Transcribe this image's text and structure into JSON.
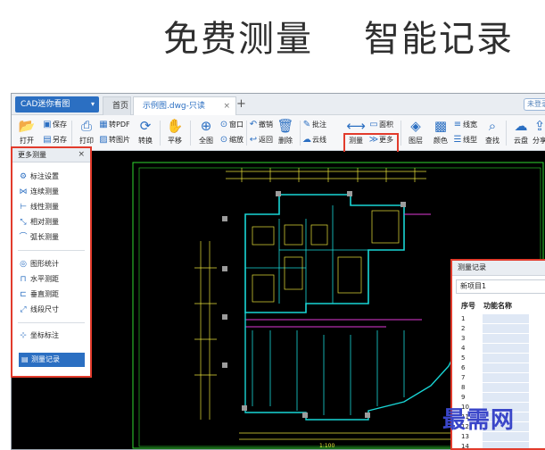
{
  "headline": {
    "left": "免费测量",
    "right": "智能记录"
  },
  "titlebar": {
    "app_menu": "CAD迷你看图",
    "tabs": [
      {
        "label": "首页"
      },
      {
        "label": "示例图.dwg-只读"
      }
    ],
    "add_tab": "+",
    "login_badge": "未登录"
  },
  "toolbar": {
    "open": "打开",
    "save": "保存",
    "save_as": "另存",
    "print": "打印",
    "to_pdf": "转PDF",
    "to_image": "转图片",
    "convert": "转换",
    "pan": "平移",
    "full_view": "全图",
    "window": "窗口",
    "zoom": "缩放",
    "undo": "撤销",
    "back": "返回",
    "delete": "删除",
    "annotate": "批注",
    "cloud_line": "云线",
    "measure": "测量",
    "area": "面积",
    "more": "更多",
    "layer": "图层",
    "color": "颜色",
    "line_width": "线宽",
    "line_type": "线型",
    "find": "查找",
    "cloud_disk": "云盘",
    "share": "分享"
  },
  "measure_panel": {
    "title": "更多测量",
    "items": [
      {
        "label": "标注设置",
        "icon": "gear-icon"
      },
      {
        "label": "连续测量",
        "icon": "chain-icon"
      },
      {
        "label": "线性测量",
        "icon": "linear-icon"
      },
      {
        "label": "相对测量",
        "icon": "relative-icon"
      },
      {
        "label": "弧长测量",
        "icon": "arc-icon"
      },
      {
        "label": "图形统计",
        "icon": "stats-icon"
      },
      {
        "label": "水平测距",
        "icon": "horizontal-icon"
      },
      {
        "label": "垂直测距",
        "icon": "vertical-icon"
      },
      {
        "label": "线段尺寸",
        "icon": "segment-icon"
      },
      {
        "label": "坐标标注",
        "icon": "coordinate-icon"
      }
    ],
    "record_button": "测量记录"
  },
  "record_panel": {
    "title": "测量记录",
    "project": "新项目1",
    "columns": [
      "序号",
      "功能名称"
    ],
    "rows": [
      "1",
      "2",
      "3",
      "4",
      "5",
      "6",
      "7",
      "8",
      "9",
      "10",
      "11",
      "12",
      "13",
      "14"
    ]
  },
  "drawing": {
    "scale_caption": "1:100"
  },
  "watermark": "最需网",
  "colors": {
    "accent": "#2b6fc2",
    "highlight": "#e23b2c",
    "cad_green": "#2fd92f",
    "cad_cyan": "#19d6d6",
    "cad_yellow": "#e9e23a",
    "cad_magenta": "#e03ad6"
  }
}
